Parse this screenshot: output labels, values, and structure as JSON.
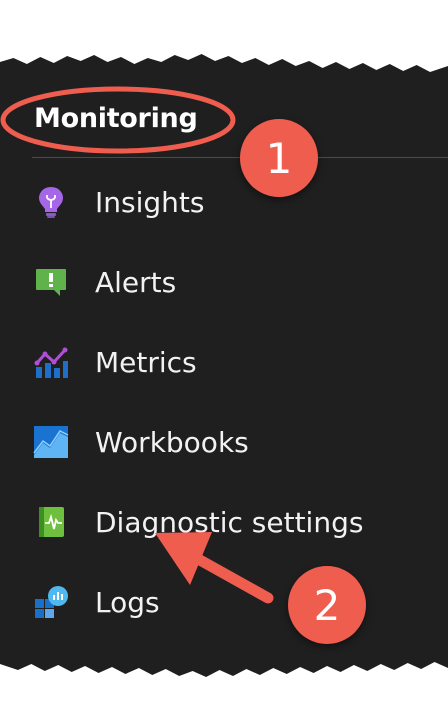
{
  "section": {
    "title": "Monitoring"
  },
  "menu": {
    "items": [
      {
        "label": "Insights",
        "icon": "lightbulb-icon"
      },
      {
        "label": "Alerts",
        "icon": "alert-icon"
      },
      {
        "label": "Metrics",
        "icon": "metrics-icon"
      },
      {
        "label": "Workbooks",
        "icon": "workbooks-icon"
      },
      {
        "label": "Diagnostic settings",
        "icon": "diagnostic-settings-icon"
      },
      {
        "label": "Logs",
        "icon": "logs-icon"
      }
    ]
  },
  "annotations": {
    "badge_1": "1",
    "badge_2": "2",
    "highlight_color": "#ef5d4f"
  },
  "colors": {
    "panel_bg": "#1f1f1f",
    "text": "#f2f2f2"
  }
}
